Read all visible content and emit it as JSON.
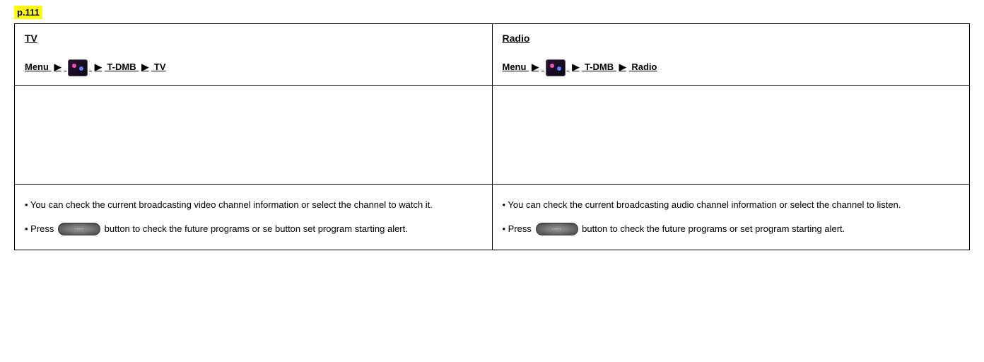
{
  "page_label": "p.111",
  "left": {
    "title": "TV",
    "path": {
      "menu": "Menu",
      "arrow": "▶",
      "step2": "T-DMB",
      "step3": "TV"
    },
    "body": {
      "line1": "•  You can check the current broadcasting video channel information or select the channel to watch it.",
      "line2_pre": "•  Press ",
      "line2_post": " button to check the future programs or se button set program starting alert."
    }
  },
  "right": {
    "title": "Radio",
    "path": {
      "menu": "Menu",
      "arrow": "▶",
      "step2": "T-DMB",
      "step3": "Radio"
    },
    "body": {
      "line1": "•  You can check the current broadcasting audio channel information or select the channel to listen.",
      "line2_pre": "•  Press ",
      "line2_post": " button to check the future programs or set program starting alert."
    }
  }
}
